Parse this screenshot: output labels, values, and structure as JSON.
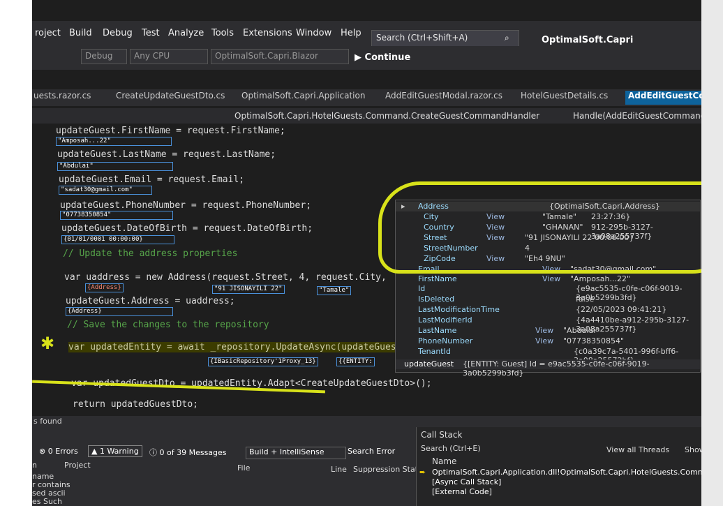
{
  "menu": [
    "roject",
    "Build",
    "Debug",
    "Test",
    "Analyze",
    "Tools",
    "Extensions",
    "Window",
    "Help"
  ],
  "search_placeholder": "Search (Ctrl+Shift+A)",
  "app_name": "OptimalSoft.Capri",
  "toolbar": {
    "config": "Debug",
    "platform": "Any CPU",
    "startup": "OptimalSoft.Capri.Blazor",
    "continue": "Continue"
  },
  "tabs": [
    "uests.razor.cs",
    "CreateUpdateGuestDto.cs",
    "OptimalSoft.Capri.Application",
    "AddEditGuestModal.razor.cs",
    "HotelGuestDetails.cs",
    "AddEditGuestComm"
  ],
  "nav": {
    "left": "OptimalSoft.Capri.HotelGuests.Command.CreateGuestCommandHandler",
    "right": "Handle(AddEditGuestCommand"
  },
  "code": [
    "updateGuest.FirstName = request.FirstName;",
    "updateGuest.LastName = request.LastName;",
    "updateGuest.Email = request.Email;",
    "updateGuest.PhoneNumber = request.PhoneNumber;",
    "updateGuest.DateOfBirth = request.DateOfBirth;",
    "// Update the address properties",
    "var uaddress = new Address(request.Street, 4, request.City,",
    "updateGuest.Address = uaddress;",
    "// Save the changes to the repository",
    "var updatedEntity = await _repository.UpdateAsync(updateGues",
    "var updatedGuestDto = updatedEntity.Adapt<CreateUpdateGuestDto>();",
    "return updatedGuestDto;"
  ],
  "data_tips": [
    "\"Amposah...22\"",
    "\"Abdulai\"",
    "\"sadat30@gmail.com\"",
    "\"07738350854\"",
    "{01/01/0001 00:00:00}",
    "{Address}",
    "\"91 JISONAYILI 22\"",
    "\"Tamale\"",
    "{Address}",
    "{IBasicRepository'1Proxy_13}",
    "{{ENTITY:"
  ],
  "datatip_rows": [
    {
      "name": "Address",
      "value": "{OptimalSoft.Capri.Address}",
      "view": ""
    },
    {
      "name": "City",
      "value": "\"Tamale\"",
      "view": "View"
    },
    {
      "name": "Country",
      "value": "\"GHANAN\"",
      "view": "View"
    },
    {
      "name": "Street",
      "value": "\"91 JISONAYILI 22\"",
      "view": "View"
    },
    {
      "name": "StreetNumber",
      "value": "4",
      "view": ""
    },
    {
      "name": "ZipCode",
      "value": "\"Eh4 9NU\"",
      "view": "View"
    },
    {
      "name": "Email",
      "value": "\"sadat30@gmail.com\"",
      "view": "View"
    },
    {
      "name": "FirstName",
      "value": "\"Amposah...22\"",
      "view": "View"
    },
    {
      "name": "Id",
      "value": "{e9ac5535-c0fe-c06f-9019-3a0b5299b3fd}",
      "view": ""
    },
    {
      "name": "IsDeleted",
      "value": "false",
      "view": ""
    },
    {
      "name": "LastModificationTime",
      "value": "{22/05/2023 09:41:21}",
      "view": ""
    },
    {
      "name": "LastModifierId",
      "value": "{4a4410be-a912-295b-3127-3a08a255737f}",
      "view": ""
    },
    {
      "name": "LastName",
      "value": "\"Abdulai\"",
      "view": "View"
    },
    {
      "name": "PhoneNumber",
      "value": "\"07738350854\"",
      "view": "View"
    },
    {
      "name": "TenantId",
      "value": "{c0a39c7a-5401-996f-bff6-3a08a25572bf}",
      "view": ""
    }
  ],
  "datatip_side": [
    "23:27:36}",
    "912-295b-3127-3a08a255737f}",
    "00:00:00}"
  ],
  "datatip_footer": {
    "name": "updateGuest",
    "value": "{[ENTITY: Guest] Id = e9ac5535-c0fe-c06f-9019-3a0b5299b3fd}"
  },
  "status_left": "s found",
  "error_list": {
    "errors": "0 Errors",
    "warnings": "1 Warning",
    "messages": "0 of 39 Messages",
    "filter": "Build + IntelliSense",
    "search": "Search Error",
    "cols": [
      "Project",
      "File",
      "Line",
      "Suppression State"
    ],
    "side": [
      "n",
      "name",
      "r contains",
      "sed ascii",
      "es Such"
    ]
  },
  "call_stack": {
    "title": "Call Stack",
    "search": "Search (Ctrl+E)",
    "view_threads": "View all Threads",
    "show": "Show",
    "col": "Name",
    "rows": [
      "OptimalSoft.Capri.Application.dll!OptimalSoft.Capri.HotelGuests.Command.Create",
      "[Async Call Stack]",
      "[External Code]"
    ]
  },
  "colors": {
    "ide_bg": "#1e1e1e",
    "accent": "#0e639c",
    "annotation": "#d8e21a"
  }
}
